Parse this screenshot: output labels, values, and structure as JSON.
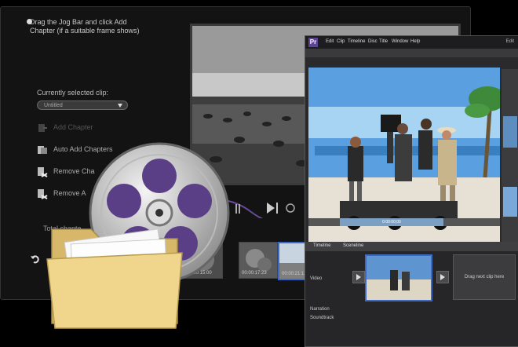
{
  "back_window": {
    "instruction": "Drag the Jog Bar and click Add Chapter (if a suitable frame shows)",
    "clip_label": "Currently selected clip:",
    "clip_value": "Untitled",
    "actions": [
      {
        "label": "Add Chapter",
        "enabled": false
      },
      {
        "label": "Auto Add Chapters",
        "enabled": true
      },
      {
        "label": "Remove Cha",
        "enabled": true
      },
      {
        "label": "Remove A",
        "enabled": true
      }
    ],
    "total_label": "Total chapte",
    "thumb_times": [
      "00:00:15:00",
      "00:00:17:23",
      "00:00:21:12"
    ]
  },
  "front_window": {
    "logo": "Pr",
    "menus": [
      "Edit",
      "Clip",
      "Timeline",
      "Disc",
      "Title",
      "Window",
      "Help"
    ],
    "win_title": "Edit",
    "scrub_label": "0:00:00;00",
    "timeline_tabs": [
      "Timeline",
      "Sceneline"
    ],
    "track_labels": [
      "Video",
      "Narration",
      "Soundtrack"
    ],
    "drag_hint": "Drag next clip here"
  },
  "colors": {
    "accent": "#3d68c4",
    "reel_purple": "#5b3f86",
    "folder_yellow": "#f0d68c"
  }
}
